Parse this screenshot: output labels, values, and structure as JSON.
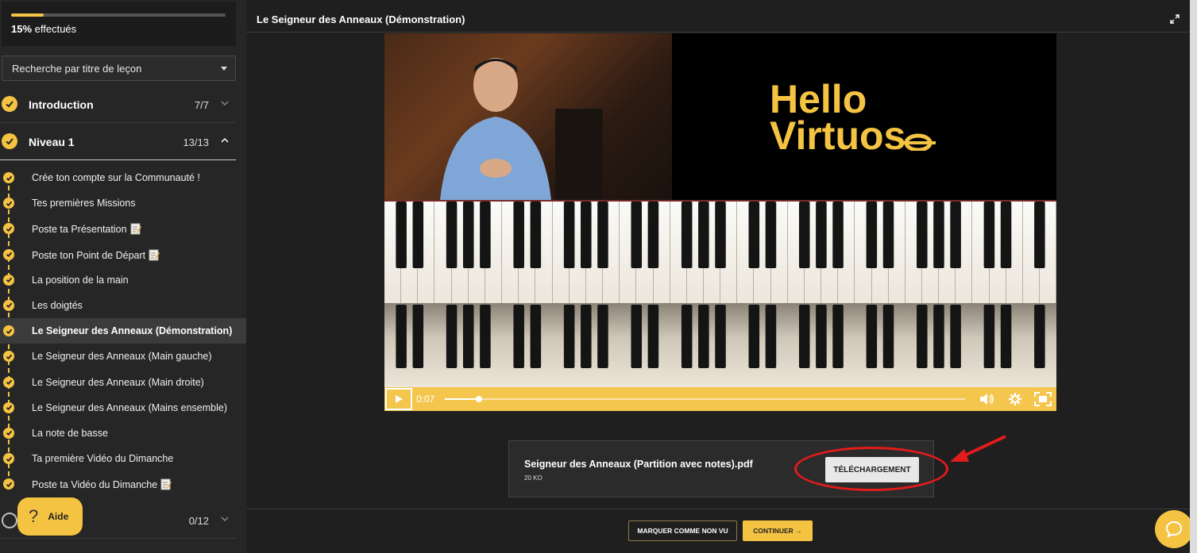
{
  "progress": {
    "percent": 15,
    "percent_text": "15%",
    "suffix": " effectués"
  },
  "search": {
    "placeholder": "Recherche par titre de leçon"
  },
  "sections": [
    {
      "title": "Introduction",
      "count": "7/7",
      "completed": true,
      "open": false
    },
    {
      "title": "Niveau 1",
      "count": "13/13",
      "completed": true,
      "open": true
    },
    {
      "title": "",
      "count": "0/12",
      "completed": false,
      "open": false
    }
  ],
  "lessons": [
    {
      "label": "Crée ton compte sur la Communauté !",
      "memo": false,
      "active": false
    },
    {
      "label": "Tes premières Missions",
      "memo": false,
      "active": false
    },
    {
      "label": "Poste ta Présentation",
      "memo": true,
      "active": false
    },
    {
      "label": "Poste ton Point de Départ",
      "memo": true,
      "active": false
    },
    {
      "label": "La position de la main",
      "memo": false,
      "active": false
    },
    {
      "label": "Les doigtés",
      "memo": false,
      "active": false
    },
    {
      "label": "Le Seigneur des Anneaux (Démonstration)",
      "memo": false,
      "active": true
    },
    {
      "label": "Le Seigneur des Anneaux (Main gauche)",
      "memo": false,
      "active": false
    },
    {
      "label": "Le Seigneur des Anneaux (Main droite)",
      "memo": false,
      "active": false
    },
    {
      "label": "Le Seigneur des Anneaux (Mains ensemble)",
      "memo": false,
      "active": false
    },
    {
      "label": "La note de basse",
      "memo": false,
      "active": false
    },
    {
      "label": "Ta première Vidéo du Dimanche",
      "memo": false,
      "active": false
    },
    {
      "label": "Poste ta Vidéo du Dimanche",
      "memo": true,
      "active": false
    }
  ],
  "help": {
    "label": "Aide"
  },
  "lesson_title": "Le Seigneur des Anneaux (Démonstration)",
  "video": {
    "brand_line1": "Hello",
    "brand_line2": "Virtuos",
    "time": "0:07",
    "progress_fraction": 0.065
  },
  "attachment": {
    "filename": "Seigneur des Anneaux (Partition avec notes).pdf",
    "size": "20 KO",
    "button_label": "TÉLÉCHARGEMENT"
  },
  "footer": {
    "mark_unseen_label": "MARQUER COMME NON VU",
    "continue_label": "CONTINUER →"
  },
  "colors": {
    "accent": "#f5c342",
    "annotation": "#e21b1b",
    "background": "#1f1f1f",
    "sidebar": "#262626"
  }
}
